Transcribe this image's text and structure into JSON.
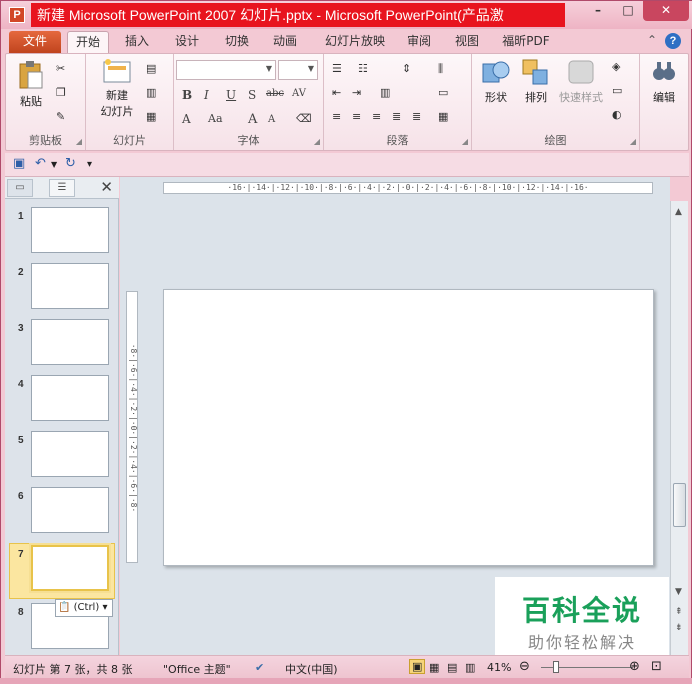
{
  "window": {
    "app_icon": "P",
    "title": "新建 Microsoft PowerPoint 2007 幻灯片.pptx - Microsoft PowerPoint(产品激",
    "minimize_icon": "minimize-icon",
    "maximize_icon": "maximize-icon",
    "close_icon": "close-icon"
  },
  "ribbon_tabs": [
    "文件",
    "开始",
    "插入",
    "设计",
    "切换",
    "动画",
    "幻灯片放映",
    "审阅",
    "视图",
    "福昕PDF"
  ],
  "ribbon_help": "?",
  "ribbon_collapse": "⌃",
  "groups": {
    "clipboard": {
      "label": "剪贴板",
      "paste": "粘贴"
    },
    "slides": {
      "label": "幻灯片",
      "new_slide_line1": "新建",
      "new_slide_line2": "幻灯片"
    },
    "font": {
      "label": "字体",
      "bold": "B",
      "italic": "I",
      "underline": "U",
      "shadow": "S",
      "strike": "abc",
      "spacing": "AV",
      "font_color": "A",
      "case": "Aa",
      "grow": "A",
      "shrink": "A"
    },
    "paragraph": {
      "label": "段落"
    },
    "drawing": {
      "label": "绘图",
      "shapes": "形状",
      "arrange": "排列",
      "quick_styles": "快速样式"
    },
    "editing": {
      "label": "编辑"
    }
  },
  "slides_panel": {
    "tab_slides_icon": "slides-tab-icon",
    "tab_outline_icon": "outline-tab-icon",
    "close": "✕",
    "numbers": [
      "1",
      "2",
      "3",
      "4",
      "5",
      "6",
      "7",
      "8"
    ],
    "selected": 7,
    "paste_options": "(Ctrl)"
  },
  "ruler": {
    "horizontal": "·16·|·14·|·12·|·10·|·8·|·6·|·4·|·2·|·0·|·2·|·4·|·6·|·8·|·10·|·12·|·14·|·16·",
    "vertical": "·8·|·6·|·4·|·2·|·0·|·2·|·4·|·6·|·8·"
  },
  "watermark": {
    "line1": "百科全说",
    "line2": "助你轻松解决"
  },
  "statusbar": {
    "slide_info": "幻灯片 第 7 张，共 8 张",
    "theme": "\"Office 主题\"",
    "language": "中文(中国)",
    "zoom": "41%",
    "zoom_fraction": 0.41
  },
  "colors": {
    "title_highlight": "#e8141e",
    "file_tab": "#d24726",
    "watermark_green": "#1aa05a"
  }
}
